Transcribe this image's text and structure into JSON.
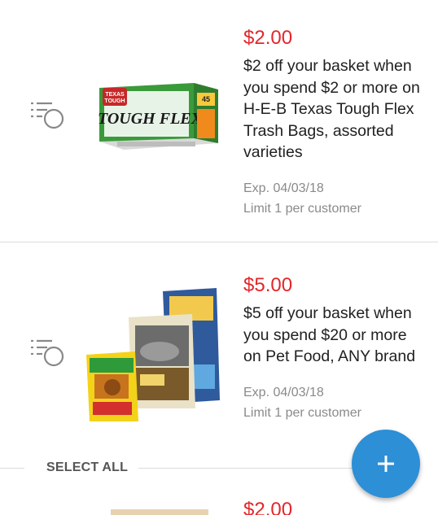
{
  "coupons": [
    {
      "price": "$2.00",
      "description": "$2 off your basket when you spend $2 or more on H-E-B Texas Tough Flex Trash Bags, assorted varieties",
      "expiration": "Exp. 04/03/18",
      "limit": "Limit 1 per customer",
      "product_image": "trash-bags-box"
    },
    {
      "price": "$5.00",
      "description": "$5 off your basket when you spend $20 or more on Pet Food, ANY brand",
      "expiration": "Exp. 04/03/18",
      "limit": "Limit 1 per customer",
      "product_image": "pet-food-bags"
    },
    {
      "price": "$2.00"
    }
  ],
  "select_all": {
    "label": "SELECT ALL"
  },
  "fab": {
    "icon": "plus-icon"
  },
  "colors": {
    "price": "#e3262a",
    "fab": "#2d8fd6",
    "meta": "#8a8a8a"
  }
}
